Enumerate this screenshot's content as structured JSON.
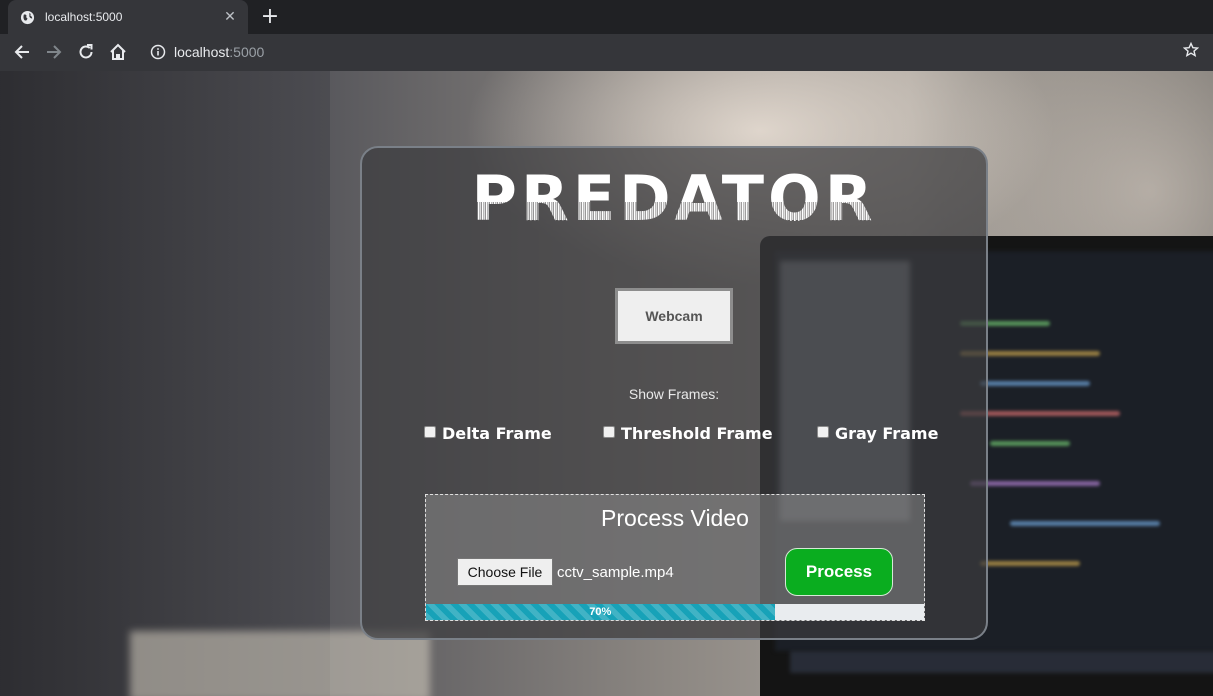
{
  "browser": {
    "tab_title": "localhost:5000",
    "url_host": "localhost",
    "url_port": ":5000",
    "tab_close": "✕",
    "new_tab": "+"
  },
  "page": {
    "logo_text": "PREDATOR",
    "webcam_label": "Webcam",
    "show_frames_label": "Show Frames:",
    "frame_options": [
      "Delta Frame",
      "Threshold Frame",
      "Gray Frame"
    ],
    "process": {
      "title": "Process Video",
      "choose_file_label": "Choose File",
      "file_name": "cctv_sample.mp4",
      "button_label": "Process",
      "progress_value": 70,
      "progress_label": "70%"
    }
  },
  "colors": {
    "process_button": "#0aad1f",
    "progress_fill": "#17a2b8"
  }
}
